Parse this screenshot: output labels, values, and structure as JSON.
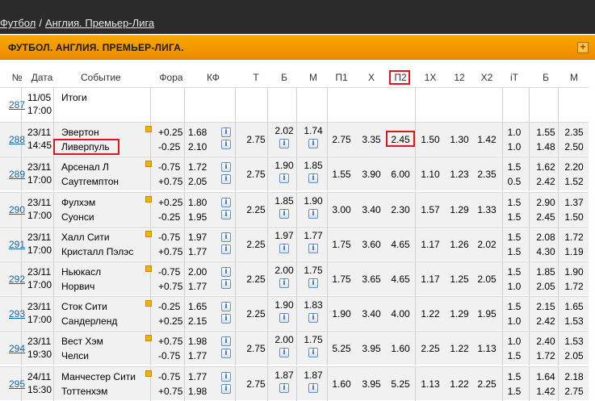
{
  "breadcrumb": [
    "Футбол",
    "Англия. Премьер-Лига"
  ],
  "breadcrumb_sep": "/",
  "section": {
    "title": "ФУТБОЛ. АНГЛИЯ. ПРЕМЬЕР-ЛИГА.",
    "plus": "+"
  },
  "info_icon": "i",
  "columns": [
    "№",
    "Дата",
    "Событие",
    "Фора",
    "КФ",
    "Т",
    "Б",
    "М",
    "П1",
    "Х",
    "П2",
    "1Х",
    "12",
    "Х2",
    "iТ",
    "Б",
    "М"
  ],
  "highlight": {
    "column": "П2",
    "team": "Ливерпуль",
    "odd": "2.45"
  },
  "rows": [
    {
      "num": "287",
      "date": "11/05",
      "time": "17:00",
      "team1": "Итоги",
      "team2": "",
      "summary": true
    },
    {
      "num": "288",
      "date": "23/11",
      "time": "14:45",
      "team1": "Эвертон",
      "team2": "Ливерпуль",
      "h1": "+0.25",
      "h2": "-0.25",
      "k1": "1.68",
      "k2": "2.10",
      "total": "2.75",
      "b": "2.02",
      "m": "1.74",
      "p1": "2.75",
      "x": "3.35",
      "p2": "2.45",
      "x1": "1.50",
      "x12": "1.30",
      "x2": "1.42",
      "it1": "1.0",
      "it2": "1.0",
      "ib1": "1.55",
      "ib2": "1.48",
      "im1": "2.35",
      "im2": "2.50"
    },
    {
      "num": "289",
      "date": "23/11",
      "time": "17:00",
      "team1": "Арсенал Л",
      "team2": "Саутгемптон",
      "h1": "-0.75",
      "h2": "+0.75",
      "k1": "1.72",
      "k2": "2.05",
      "total": "2.75",
      "b": "1.90",
      "m": "1.85",
      "p1": "1.55",
      "x": "3.90",
      "p2": "6.00",
      "x1": "1.10",
      "x12": "1.23",
      "x2": "2.35",
      "it1": "1.5",
      "it2": "0.5",
      "ib1": "1.62",
      "ib2": "2.42",
      "im1": "2.20",
      "im2": "1.52"
    },
    {
      "num": "290",
      "date": "23/11",
      "time": "17:00",
      "team1": "Фулхэм",
      "team2": "Суонси",
      "h1": "+0.25",
      "h2": "-0.25",
      "k1": "1.80",
      "k2": "1.95",
      "total": "2.25",
      "b": "1.85",
      "m": "1.90",
      "p1": "3.00",
      "x": "3.40",
      "p2": "2.30",
      "x1": "1.57",
      "x12": "1.29",
      "x2": "1.33",
      "it1": "1.5",
      "it2": "1.5",
      "ib1": "2.90",
      "ib2": "2.45",
      "im1": "1.37",
      "im2": "1.50"
    },
    {
      "num": "291",
      "date": "23/11",
      "time": "17:00",
      "team1": "Халл Сити",
      "team2": "Кристалл Пэлэс",
      "h1": "-0.75",
      "h2": "+0.75",
      "k1": "1.97",
      "k2": "1.77",
      "total": "2.25",
      "b": "1.97",
      "m": "1.77",
      "p1": "1.75",
      "x": "3.60",
      "p2": "4.65",
      "x1": "1.17",
      "x12": "1.26",
      "x2": "2.02",
      "it1": "1.5",
      "it2": "1.5",
      "ib1": "2.08",
      "ib2": "4.30",
      "im1": "1.72",
      "im2": "1.19"
    },
    {
      "num": "292",
      "date": "23/11",
      "time": "17:00",
      "team1": "Ньюкасл",
      "team2": "Норвич",
      "h1": "-0.75",
      "h2": "+0.75",
      "k1": "2.00",
      "k2": "1.77",
      "total": "2.25",
      "b": "2.00",
      "m": "1.75",
      "p1": "1.75",
      "x": "3.65",
      "p2": "4.65",
      "x1": "1.17",
      "x12": "1.25",
      "x2": "2.05",
      "it1": "1.5",
      "it2": "1.0",
      "ib1": "1.85",
      "ib2": "2.05",
      "im1": "1.90",
      "im2": "1.72"
    },
    {
      "num": "293",
      "date": "23/11",
      "time": "17:00",
      "team1": "Сток Сити",
      "team2": "Сандерленд",
      "h1": "-0.25",
      "h2": "+0.25",
      "k1": "1.65",
      "k2": "2.15",
      "total": "2.25",
      "b": "1.90",
      "m": "1.83",
      "p1": "1.90",
      "x": "3.40",
      "p2": "4.00",
      "x1": "1.22",
      "x12": "1.29",
      "x2": "1.95",
      "it1": "1.5",
      "it2": "1.0",
      "ib1": "2.15",
      "ib2": "2.42",
      "im1": "1.65",
      "im2": "1.53"
    },
    {
      "num": "294",
      "date": "23/11",
      "time": "19:30",
      "team1": "Вест Хэм",
      "team2": "Челси",
      "h1": "+0.75",
      "h2": "-0.75",
      "k1": "1.98",
      "k2": "1.77",
      "total": "2.75",
      "b": "2.00",
      "m": "1.75",
      "p1": "5.25",
      "x": "3.95",
      "p2": "1.60",
      "x1": "2.25",
      "x12": "1.22",
      "x2": "1.13",
      "it1": "1.0",
      "it2": "1.5",
      "ib1": "2.40",
      "ib2": "1.72",
      "im1": "1.53",
      "im2": "2.05"
    },
    {
      "num": "295",
      "date": "24/11",
      "time": "15:30",
      "team1": "Манчестер Сити",
      "team2": "Тоттенхэм",
      "h1": "-0.75",
      "h2": "+0.75",
      "k1": "1.77",
      "k2": "1.98",
      "total": "2.75",
      "b": "1.87",
      "m": "1.87",
      "p1": "1.60",
      "x": "3.95",
      "p2": "5.25",
      "x1": "1.13",
      "x12": "1.22",
      "x2": "2.25",
      "it1": "1.5",
      "it2": "1.5",
      "ib1": "1.64",
      "ib2": "1.42",
      "im1": "2.18",
      "im2": "2.75"
    }
  ]
}
